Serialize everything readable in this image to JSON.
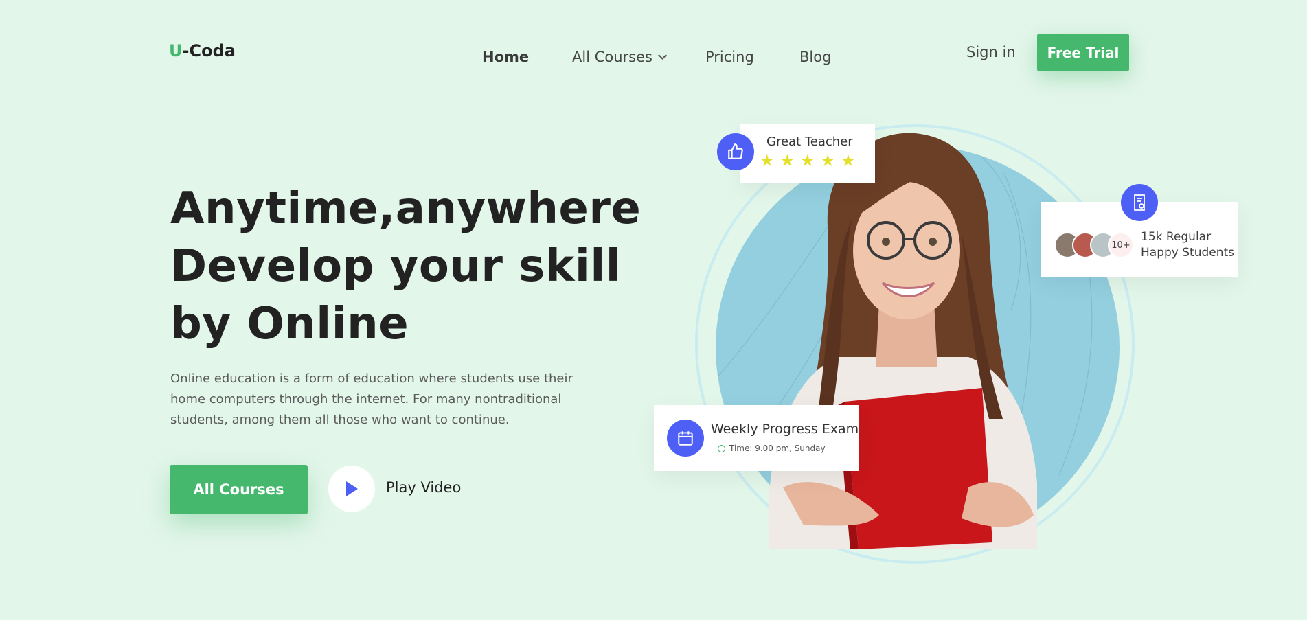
{
  "header": {
    "logo_u": "U",
    "logo_rest": "-Coda",
    "nav": {
      "home": "Home",
      "all_courses": "All Courses",
      "pricing": "Pricing",
      "blog": "Blog"
    },
    "sign_in": "Sign in",
    "free_trial": "Free Trial"
  },
  "hero": {
    "title_lines": [
      "Anytime,anywhere",
      "Develop your skill",
      "by Online"
    ],
    "description": "Online education is a form of education where students use their home computers through the internet. For many nontraditional students, among them all those who want to continue.",
    "cta_primary": "All Courses",
    "cta_video": "Play Video"
  },
  "cards": {
    "teacher": {
      "title": "Great Teacher",
      "rating_stars": 5
    },
    "students": {
      "avatar_more": "10+",
      "line1": "15k Regular",
      "line2": "Happy Students"
    },
    "exam": {
      "title": "Weekly Progress Exam",
      "time": "Time: 9.00 pm, Sunday"
    }
  },
  "colors": {
    "background": "#e3f6ea",
    "accent_green": "#46b86e",
    "badge_blue": "#4d5ff5",
    "star_yellow": "#e4e02a",
    "circle_blue": "#93cfdf"
  },
  "icons": {
    "teacher_badge": "thumbs-up-icon",
    "students_badge": "certificate-icon",
    "exam_badge": "calendar-icon",
    "exam_time": "clock-icon",
    "play": "play-icon",
    "nav_dropdown": "chevron-down-icon"
  }
}
